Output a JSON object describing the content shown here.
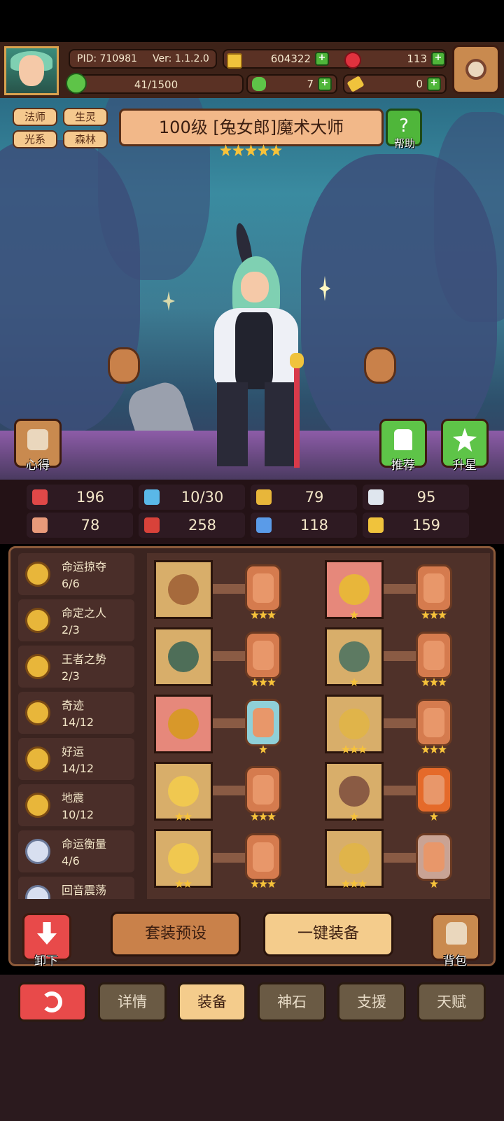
{
  "header": {
    "pid_label": "PID: 710981",
    "version_label": "Ver: 1.1.2.0",
    "gold": "604322",
    "gems": "113",
    "exp": "41/1500",
    "exp_progress": 0.027,
    "clover": "7",
    "keys": "0"
  },
  "hero": {
    "tags": [
      "法师",
      "生灵",
      "光系",
      "森林"
    ],
    "title": "100级  [兔女郎]魔术大师",
    "star_count": 5,
    "help_label": "帮助",
    "notes_label": "心得",
    "recommend_label": "推荐",
    "starup_label": "升星"
  },
  "stats": [
    {
      "icon": "heart-icon",
      "value": "196",
      "color": "#e04848"
    },
    {
      "icon": "water-drop-icon",
      "value": "10/30",
      "color": "#5ab8e8"
    },
    {
      "icon": "shield-icon",
      "value": "79",
      "color": "#e8b63a"
    },
    {
      "icon": "wing-icon",
      "value": "95",
      "color": "#dfe6ee"
    },
    {
      "icon": "fist-icon",
      "value": "78",
      "color": "#e89a7a"
    },
    {
      "icon": "book-icon",
      "value": "258",
      "color": "#d8423a"
    },
    {
      "icon": "boot-icon",
      "value": "118",
      "color": "#5a9be8"
    },
    {
      "icon": "horseshoe-icon",
      "value": "159",
      "color": "#f0c33c"
    }
  ],
  "skills": [
    {
      "name": "命运掠夺",
      "count": "6/6"
    },
    {
      "name": "命定之人",
      "count": "2/3"
    },
    {
      "name": "王者之势",
      "count": "2/3"
    },
    {
      "name": "奇迹",
      "count": "14/12"
    },
    {
      "name": "好运",
      "count": "14/12"
    },
    {
      "name": "地震",
      "count": "10/12"
    },
    {
      "name": "命运衡量",
      "count": "4/6"
    },
    {
      "name": "回音震荡",
      "count": ""
    }
  ],
  "equipment": [
    {
      "item": "staff-icon",
      "item_stars": 0,
      "rune_stars": 3,
      "red": false,
      "rune_color": "#d57b4e"
    },
    {
      "item": "straw-hat-icon",
      "item_stars": 1,
      "rune_stars": 3,
      "red": true,
      "rune_color": "#d57b4e"
    },
    {
      "item": "orb-icon",
      "item_stars": 0,
      "rune_stars": 3,
      "red": false,
      "rune_color": "#d57b4e"
    },
    {
      "item": "armor-icon",
      "item_stars": 1,
      "rune_stars": 3,
      "red": false,
      "rune_color": "#d57b4e"
    },
    {
      "item": "necklace-icon",
      "item_stars": 0,
      "rune_stars": 1,
      "red": true,
      "rune_color": "#8fd0d8"
    },
    {
      "item": "gauntlet-icon",
      "item_stars": 3,
      "rune_stars": 3,
      "red": false,
      "rune_color": "#d57b4e"
    },
    {
      "item": "jewel-icon",
      "item_stars": 2,
      "rune_stars": 3,
      "red": false,
      "rune_color": "#d57b4e"
    },
    {
      "item": "belt-icon",
      "item_stars": 1,
      "rune_stars": 1,
      "red": false,
      "rune_color": "#e56a2a"
    },
    {
      "item": "ring-icon",
      "item_stars": 2,
      "rune_stars": 3,
      "red": false,
      "rune_color": "#d57b4e"
    },
    {
      "item": "boots-icon",
      "item_stars": 3,
      "rune_stars": 1,
      "red": false,
      "rune_color": "#c9a394"
    }
  ],
  "actions": {
    "unequip_label": "卸下",
    "preset_label": "套装预设",
    "one_click_label": "一键装备",
    "bag_label": "背包"
  },
  "tabs": [
    "详情",
    "装备",
    "神石",
    "支援",
    "天赋"
  ],
  "active_tab": 1
}
